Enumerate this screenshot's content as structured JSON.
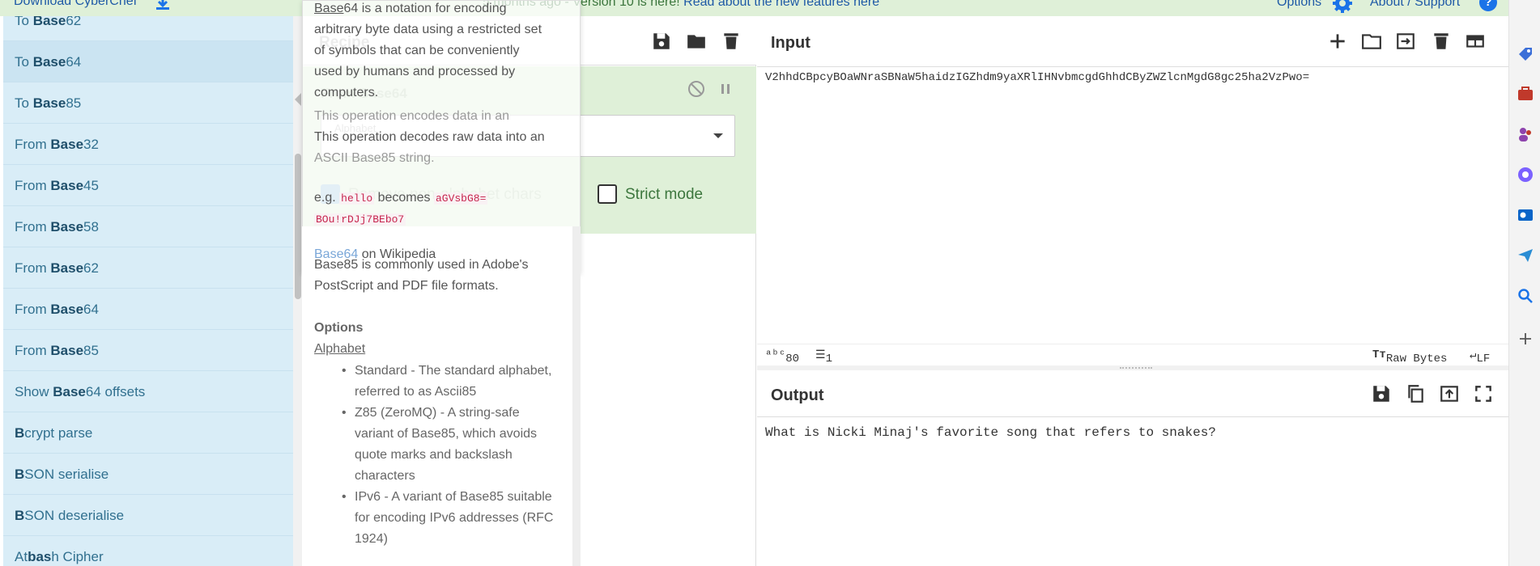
{
  "banner": {
    "download_label": "Download CyberChef",
    "notice_prefix": "5 months ago - Version 10 is here! ",
    "notice_link": "Read about the new features here",
    "options_label": "Options",
    "about_label": "About / Support",
    "help_label": "?"
  },
  "operations": {
    "items": [
      {
        "pre": "To ",
        "bold": "Base",
        "post": "62"
      },
      {
        "pre": "To ",
        "bold": "Base",
        "post": "64"
      },
      {
        "pre": "To ",
        "bold": "Base",
        "post": "85"
      },
      {
        "pre": "From ",
        "bold": "Base",
        "post": "32"
      },
      {
        "pre": "From ",
        "bold": "Base",
        "post": "45"
      },
      {
        "pre": "From ",
        "bold": "Base",
        "post": "58"
      },
      {
        "pre": "From ",
        "bold": "Base",
        "post": "62"
      },
      {
        "pre": "From ",
        "bold": "Base",
        "post": "64"
      },
      {
        "pre": "From ",
        "bold": "Base",
        "post": "85"
      },
      {
        "pre": "Show ",
        "bold": "Base",
        "post": "64 offsets"
      },
      {
        "pre": "",
        "bold": "B",
        "post": "crypt parse"
      },
      {
        "pre": "",
        "bold": "B",
        "post": "SON serialise"
      },
      {
        "pre": "",
        "bold": "B",
        "post": "SON deserialise"
      },
      {
        "pre": "At",
        "bold": "bas",
        "post": "h Cipher"
      }
    ]
  },
  "recipe": {
    "title": "Recipe",
    "operation_name": "From Base64",
    "alphabet_label": "Alphabet",
    "remove_label": "Remove non-alphabet chars",
    "strict_label": "Strict mode"
  },
  "popover": {
    "lines": [
      {
        "pre": "",
        "u": "Base",
        "post": "64 is a notation for encoding"
      },
      {
        "pre": "arbitrary byte data using a restricted set",
        "u": "",
        "post": ""
      },
      {
        "pre": "of symbols that can be conveniently",
        "u": "",
        "post": ""
      },
      {
        "pre": "used by humans and processed by",
        "u": "",
        "post": ""
      },
      {
        "pre": "computers.",
        "u": "",
        "post": ""
      }
    ],
    "encode_1": "This operation encodes data in an",
    "encode_2": "ASCII Base64 string.",
    "decode_1": "This operation decodes raw data into an",
    "decode_2": "ASCII Base85 string.",
    "eg_prefix": "e.g. ",
    "eg_code": "hello",
    "eg_mid": " becomes ",
    "eg_result": "aGVsbG8=",
    "eg_b85": "BOu!rDJj7BEbo7",
    "wiki_link": "Base64",
    "wiki_suffix": " on Wikipedia",
    "b85_usage_1": "Base85 is commonly used in Adobe's",
    "b85_usage_2": "PostScript and PDF file formats.",
    "options_heading": "Options",
    "alphabet_heading": "Alphabet",
    "alphabet_options": [
      "Standard - The standard alphabet, referred to as Ascii85",
      "Z85 (ZeroMQ) - A string-safe variant of Base85, which avoids quote marks and backslash characters",
      "IPv6 - A variant of Base85 suitable for encoding IPv6 addresses (RFC 1924)"
    ]
  },
  "input": {
    "title": "Input",
    "value": "V2hhdCBpcyBOaWNraSBNaW5haidzIGZhdm9yaXRlIHNvbmcgdGhhdCByZWZlcnMgdG8gc25ha2VzPwo=",
    "length": "80",
    "lines": "1",
    "encoding": "Raw Bytes",
    "eol": "LF"
  },
  "output": {
    "title": "Output",
    "value": "What is Nicki Minaj's favorite song that refers to snakes?"
  },
  "colors": {
    "ops_bg": "#d9edf7",
    "op_bg": "#dff0d8",
    "accent": "#1a73e8"
  }
}
